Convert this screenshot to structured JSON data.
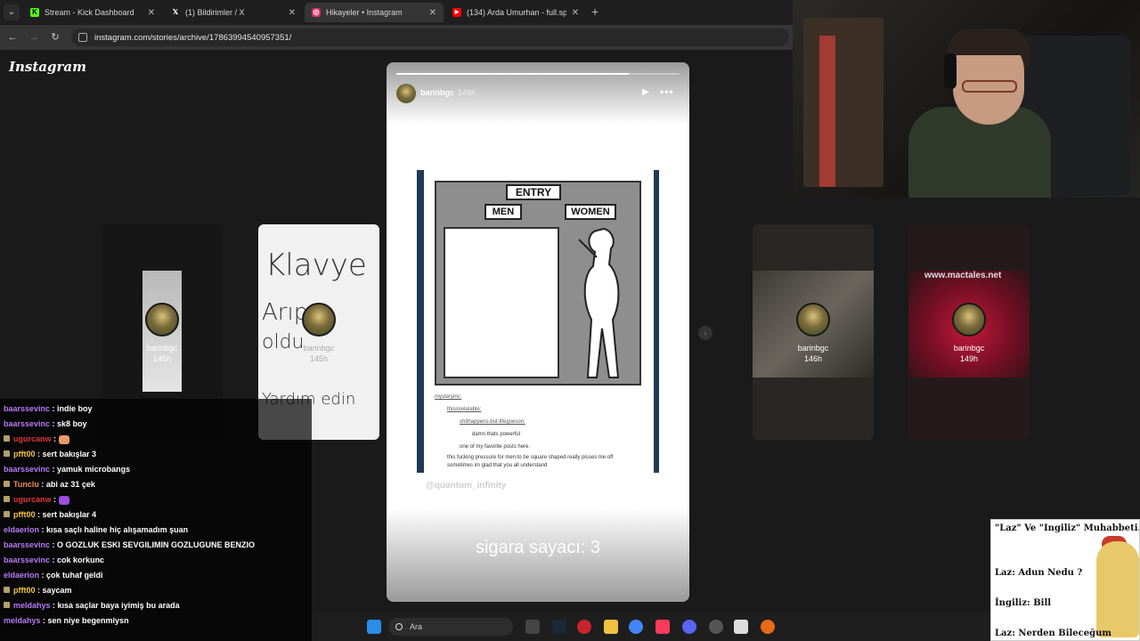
{
  "browser": {
    "tabs": [
      {
        "title": "Stream - Kick Dashboard",
        "icon": "kick-icon",
        "color": "#53fc18",
        "glyph": "K"
      },
      {
        "title": "(1) Bildirimler / X",
        "icon": "x-icon",
        "color": "#ffffff",
        "glyph": "X"
      },
      {
        "title": "Hikayeler • Instagram",
        "icon": "instagram-icon",
        "color": "#e1306c",
        "glyph": "◎"
      },
      {
        "title": "(134) Arda Umurhan - full.spac",
        "icon": "youtube-icon",
        "color": "#ff0000",
        "glyph": "▶"
      }
    ],
    "address": "instagram.com/stories/archive/17863994540957351/"
  },
  "instagram": {
    "logo": "Instagram",
    "story": {
      "username": "barinbgc",
      "time": "146h",
      "progress": 0.82,
      "comic": {
        "entry": "ENTRY",
        "men": "MEN",
        "women": "WOMEN",
        "tumblr_lines": [
          "mysteryinc:",
          "thisisrelatable:",
          "shithappens-but-lifegoeson:",
          "damn thats powerful",
          "one of my favorite posts here.",
          "this fucking pressure for men to be square shaped really pisses me off",
          "sometimes im glad that you all understand"
        ]
      },
      "watermark": "@quantum_infinity",
      "counter": "sigara sayacı: 3"
    },
    "side_stories": [
      {
        "username": "barinbgc",
        "time": "145h"
      },
      {
        "username": "barinbgc",
        "time": "145h",
        "handwriting": [
          "Klavye",
          "Arıpça",
          "oldu",
          "Yardım edin"
        ]
      },
      {
        "username": "barinbgc",
        "time": "146h"
      },
      {
        "username": "barinbgc",
        "time": "149h",
        "overlay_text": "www.mactales.net"
      }
    ]
  },
  "chat": [
    {
      "user": "baarssevinc",
      "msg": "indie boy",
      "color": "#b678f5",
      "badge": false
    },
    {
      "user": "baarssevinc",
      "msg": "sk8 boy",
      "color": "#b678f5",
      "badge": false
    },
    {
      "user": "ugurcanw",
      "msg": "",
      "color": "#e0353d",
      "badge": true,
      "emote": "#e89a6a"
    },
    {
      "user": "pfft00",
      "msg": "sert bakışlar 3",
      "color": "#f5c542",
      "badge": true
    },
    {
      "user": "baarssevinc",
      "msg": "yamuk microbangs",
      "color": "#b678f5",
      "badge": false
    },
    {
      "user": "Tunclu",
      "msg": "abi az 31 çek",
      "color": "#f08a5d",
      "badge": true
    },
    {
      "user": "ugurcanw",
      "msg": "",
      "color": "#e0353d",
      "badge": true,
      "emote": "#9b4de0"
    },
    {
      "user": "pfft00",
      "msg": "sert bakışlar 4",
      "color": "#f5c542",
      "badge": true
    },
    {
      "user": "eldaerion",
      "msg": "kısa saçlı haline hiç alışamadım şuan",
      "color": "#b678f5",
      "badge": false
    },
    {
      "user": "baarssevinc",
      "msg": "O GOZLUK ESKI SEVGILIMIN GOZLUGUNE BENZIO",
      "color": "#b678f5",
      "badge": false
    },
    {
      "user": "baarssevinc",
      "msg": "cok korkunc",
      "color": "#b678f5",
      "badge": false
    },
    {
      "user": "eldaerion",
      "msg": "çok tuhaf geldi",
      "color": "#b678f5",
      "badge": false
    },
    {
      "user": "pfft00",
      "msg": "saycam",
      "color": "#f5c542",
      "badge": true
    },
    {
      "user": "meldahys",
      "msg": "kısa saçlar baya iyimiş bu arada",
      "color": "#b678f5",
      "badge": true
    },
    {
      "user": "meldahys",
      "msg": "sen niye begenmiysn",
      "color": "#b678f5",
      "badge": false
    }
  ],
  "taskbar": {
    "search_label": "Ara"
  },
  "meme": {
    "title": "\"Laz\" Ve \"Ingiliz\" Muhabbeti..",
    "lines": [
      "Laz: Adun Nedu ?",
      "İngiliz: Bill",
      "Laz: Nerden Bileceğum"
    ]
  }
}
